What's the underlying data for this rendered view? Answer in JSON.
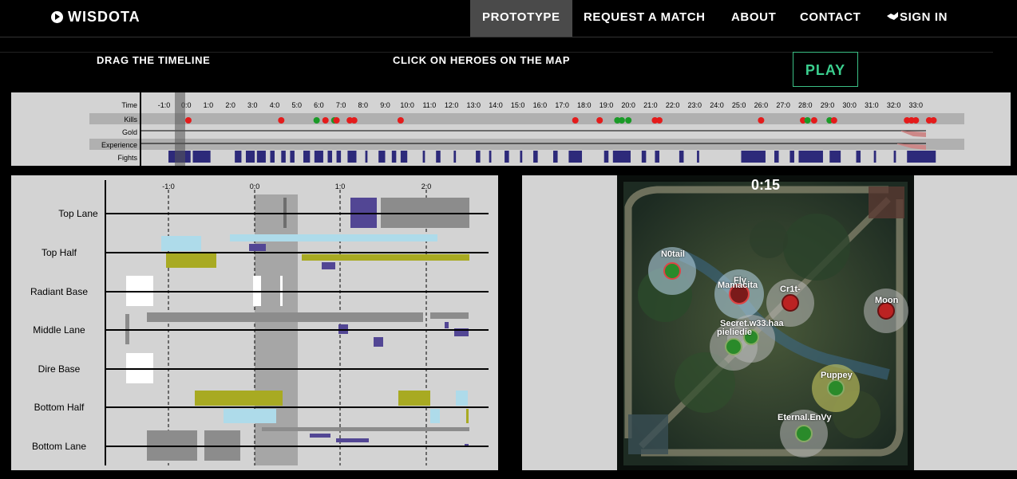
{
  "nav": {
    "brand": "WISDOTA",
    "items": [
      "PROTOTYPE",
      "REQUEST A MATCH",
      "ABOUT",
      "CONTACT"
    ],
    "signin": "SIGN IN"
  },
  "controls": {
    "drag_hint": "DRAG THE TIMELINE",
    "click_hint": "CLICK ON HEROES ON THE MAP",
    "play": "PLAY"
  },
  "timeline": {
    "row_labels": [
      "Time",
      "Kills",
      "Gold",
      "Experience",
      "Fights"
    ],
    "ticks": [
      "-1:0",
      "0:0",
      "1:0",
      "2:0",
      "3:0",
      "4:0",
      "5:0",
      "6:0",
      "7:0",
      "8:0",
      "9:0",
      "10:0",
      "11:0",
      "12:0",
      "13:0",
      "14:0",
      "15:0",
      "16:0",
      "17:0",
      "18:0",
      "19:0",
      "20:0",
      "21:0",
      "22:0",
      "23:0",
      "24:0",
      "25:0",
      "26:0",
      "27:0",
      "28:0",
      "29:0",
      "30:0",
      "31:0",
      "32:0",
      "33:0"
    ],
    "kills": [
      {
        "t": 0.1,
        "team": "dire"
      },
      {
        "t": 4.3,
        "team": "dire"
      },
      {
        "t": 5.9,
        "team": "radiant"
      },
      {
        "t": 6.3,
        "team": "dire"
      },
      {
        "t": 6.7,
        "team": "radiant"
      },
      {
        "t": 6.8,
        "team": "dire"
      },
      {
        "t": 7.4,
        "team": "dire"
      },
      {
        "t": 7.6,
        "team": "dire"
      },
      {
        "t": 9.7,
        "team": "dire"
      },
      {
        "t": 17.6,
        "team": "dire"
      },
      {
        "t": 18.7,
        "team": "dire"
      },
      {
        "t": 19.5,
        "team": "radiant"
      },
      {
        "t": 19.7,
        "team": "radiant"
      },
      {
        "t": 20.0,
        "team": "radiant"
      },
      {
        "t": 21.2,
        "team": "dire"
      },
      {
        "t": 21.4,
        "team": "dire"
      },
      {
        "t": 26.0,
        "team": "dire"
      },
      {
        "t": 27.9,
        "team": "dire"
      },
      {
        "t": 28.1,
        "team": "radiant"
      },
      {
        "t": 28.4,
        "team": "dire"
      },
      {
        "t": 29.1,
        "team": "radiant"
      },
      {
        "t": 29.3,
        "team": "dire"
      },
      {
        "t": 32.6,
        "team": "dire"
      },
      {
        "t": 32.8,
        "team": "dire"
      },
      {
        "t": 33.0,
        "team": "dire"
      },
      {
        "t": 33.6,
        "team": "dire"
      },
      {
        "t": 33.8,
        "team": "dire"
      }
    ],
    "fights": [
      [
        -0.8,
        0.2
      ],
      [
        0.3,
        1.1
      ],
      [
        2.2,
        2.5
      ],
      [
        2.7,
        3.1
      ],
      [
        3.2,
        3.6
      ],
      [
        3.8,
        4.0
      ],
      [
        4.3,
        4.5
      ],
      [
        4.7,
        4.9
      ],
      [
        5.3,
        5.6
      ],
      [
        5.8,
        6.2
      ],
      [
        6.4,
        6.6
      ],
      [
        6.8,
        7.0
      ],
      [
        7.3,
        7.7
      ],
      [
        8.1,
        8.2
      ],
      [
        8.7,
        9.0
      ],
      [
        9.3,
        9.5
      ],
      [
        9.7,
        10.0
      ],
      [
        10.7,
        10.8
      ],
      [
        11.3,
        11.5
      ],
      [
        12.1,
        12.2
      ],
      [
        13.1,
        13.3
      ],
      [
        13.7,
        13.8
      ],
      [
        14.4,
        14.6
      ],
      [
        15.1,
        15.2
      ],
      [
        15.7,
        15.9
      ],
      [
        16.6,
        16.8
      ],
      [
        17.3,
        17.9
      ],
      [
        18.9,
        19.1
      ],
      [
        19.3,
        20.1
      ],
      [
        20.6,
        20.8
      ],
      [
        21.2,
        21.4
      ],
      [
        22.3,
        22.5
      ],
      [
        23.1,
        23.2
      ],
      [
        25.1,
        26.2
      ],
      [
        26.6,
        26.8
      ],
      [
        27.3,
        27.5
      ],
      [
        27.7,
        28.8
      ],
      [
        29.1,
        29.6
      ],
      [
        30.3,
        30.5
      ],
      [
        31.1,
        31.2
      ],
      [
        32.0,
        32.1
      ],
      [
        32.6,
        33.9
      ]
    ]
  },
  "lanes": {
    "rows": [
      "Top Lane",
      "Top Half",
      "Radiant Base",
      "Middle Lane",
      "Dire Base",
      "Bottom Half",
      "Bottom Lane"
    ],
    "ticks": [
      "-1:0",
      "0:0",
      "1:0",
      "2:0"
    ]
  },
  "map": {
    "time": "0:15",
    "heroes": [
      {
        "name": "N0tail",
        "team": "radiant",
        "size": "large",
        "halo": "light"
      },
      {
        "name": "Fly",
        "team": "radiant",
        "size": "large",
        "halo": "light"
      },
      {
        "name": "Mamacita",
        "team": "dire",
        "size": "large",
        "halo": "light"
      },
      {
        "name": "Cr1t-",
        "team": "dire",
        "size": "medium",
        "halo": "gray"
      },
      {
        "name": "Moon",
        "team": "dire",
        "size": "medium",
        "halo": "gray"
      },
      {
        "name": "Secret.w33.haa",
        "team": "radiant",
        "size": "small",
        "halo": "gray"
      },
      {
        "name": "pieliedie",
        "team": "radiant",
        "size": "medium",
        "halo": "gray"
      },
      {
        "name": "Puppey",
        "team": "radiant",
        "size": "medium",
        "halo": "gold"
      },
      {
        "name": "Eternal.EnVy",
        "team": "radiant",
        "size": "medium",
        "halo": "gray"
      }
    ]
  },
  "colors": {
    "accent": "#3bcf8f",
    "kill_dire": "#e41b1b",
    "kill_radiant": "#1a9a27",
    "fight": "#2d2a7a",
    "lane_gray": "#8c8c8c",
    "lane_olive": "#a8aa22",
    "lane_sky": "#aedbea",
    "lane_purple": "#524694",
    "white": "#ffffff"
  }
}
